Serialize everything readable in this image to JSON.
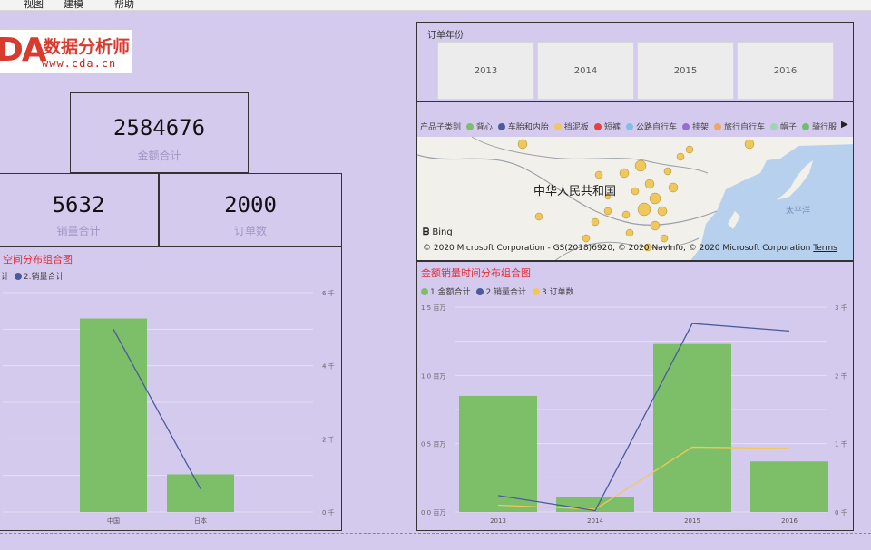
{
  "menu": [
    "视图",
    "建模",
    "帮助"
  ],
  "logo": {
    "mark": "DA",
    "name": "数据分析师",
    "url": "www.cda.cn"
  },
  "kpis": {
    "amount": {
      "value": "2584676",
      "label": "金额合计"
    },
    "quantity": {
      "value": "5632",
      "label": "销量合计"
    },
    "orders": {
      "value": "2000",
      "label": "订单数"
    }
  },
  "year_slicer": {
    "title": "订单年份",
    "years": [
      "2013",
      "2014",
      "2015",
      "2016"
    ]
  },
  "map": {
    "legend_title": "产品子类别",
    "legend_items": [
      {
        "label": "背心",
        "color": "#7dbf69"
      },
      {
        "label": "车胎和内胎",
        "color": "#4b5a9b"
      },
      {
        "label": "挡泥板",
        "color": "#f0c75a"
      },
      {
        "label": "短裤",
        "color": "#e0453a"
      },
      {
        "label": "公路自行车",
        "color": "#7cc0e8"
      },
      {
        "label": "挂架",
        "color": "#9a6bd0"
      },
      {
        "label": "旅行自行车",
        "color": "#f2a65e"
      },
      {
        "label": "帽子",
        "color": "#9fd5b4"
      },
      {
        "label": "骑行服",
        "color": "#6cc06c"
      }
    ],
    "country_label": "中华人民共和国",
    "ocean_label": "太平洋",
    "bing_label": "Bing",
    "copyright": "© 2020 Microsoft Corporation - GS(2018)6920, © 2020 NavInfo, © 2020 Microsoft Corporation",
    "terms": "Terms"
  },
  "left_chart": {
    "title_fragment": "空间分布组合图",
    "legend_fragment": "计",
    "legend_series": "2.销量合计",
    "colors": {
      "bar": "#7dbf69",
      "line": "#4b5a9b"
    }
  },
  "right_chart": {
    "title": "金额销量时间分布组合图",
    "legend": [
      {
        "label": "1.金额合计",
        "color": "#7dbf69"
      },
      {
        "label": "2.销量合计",
        "color": "#4b5a9b"
      },
      {
        "label": "3.订单数",
        "color": "#f0c75a"
      }
    ]
  },
  "chart_data": [
    {
      "type": "bar",
      "categories": [
        "中国",
        "日本"
      ],
      "series": [
        {
          "name": "2.销量合计",
          "kind": "line",
          "axis": "right",
          "values": [
            5000,
            632
          ]
        }
      ],
      "bar_values": [
        2160000,
        420000
      ],
      "y2lim": [
        0,
        6000
      ],
      "y2ticks": [
        "0 千",
        "2 千",
        "4 千",
        "6 千"
      ]
    },
    {
      "type": "bar",
      "categories": [
        "2013",
        "2014",
        "2015",
        "2016"
      ],
      "series": [
        {
          "name": "1.金额合计",
          "kind": "bar",
          "axis": "left",
          "values": [
            850000,
            110000,
            1230000,
            370000
          ]
        },
        {
          "name": "2.销量合计",
          "kind": "line",
          "axis": "right",
          "values": 0
        },
        {
          "name": "3.订单数",
          "kind": "line",
          "axis": "right",
          "values": [
            100,
            40,
            950,
            930
          ]
        }
      ],
      "sales_line": [
        240,
        20,
        2760,
        2650
      ],
      "ylim": [
        0,
        1500000
      ],
      "y2lim": [
        0,
        3000
      ],
      "yticks": [
        "0.0 百万",
        "0.5 百万",
        "1.0 百万",
        "1.5 百万"
      ],
      "y2ticks": [
        "0 千",
        "1 千",
        "2 千",
        "3 千"
      ]
    }
  ]
}
